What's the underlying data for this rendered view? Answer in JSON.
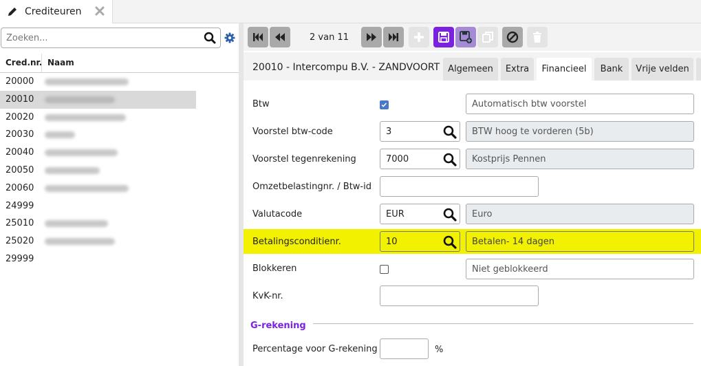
{
  "window": {
    "tab_title": "Crediteuren"
  },
  "list": {
    "search_placeholder": "Zoeken...",
    "columns": [
      "Cred.nr.",
      "Naam"
    ],
    "rows": [
      {
        "nr": "20000",
        "selected": false
      },
      {
        "nr": "20010",
        "selected": true
      },
      {
        "nr": "20020",
        "selected": false
      },
      {
        "nr": "20030",
        "selected": false
      },
      {
        "nr": "20040",
        "selected": false
      },
      {
        "nr": "20050",
        "selected": false
      },
      {
        "nr": "20060",
        "selected": false
      },
      {
        "nr": "24999",
        "selected": false
      },
      {
        "nr": "25010",
        "selected": false
      },
      {
        "nr": "25020",
        "selected": false
      },
      {
        "nr": "29999",
        "selected": false
      }
    ]
  },
  "toolbar": {
    "pager": "2 van 11"
  },
  "record": {
    "title": "20010 - Intercompu B.V. - ZANDVOORT",
    "tabs": [
      "Algemeen",
      "Extra",
      "Financieel",
      "Bank",
      "Vrije velden"
    ],
    "active_tab": "Financieel"
  },
  "form": {
    "btw": {
      "label": "Btw",
      "checked": true,
      "desc": "Automatisch btw voorstel"
    },
    "voorstel_btw": {
      "label": "Voorstel btw-code",
      "value": "3",
      "desc": "BTW hoog te vorderen (5b)"
    },
    "voorstel_tegen": {
      "label": "Voorstel tegenrekening",
      "value": "7000",
      "desc": "Kostprijs Pennen"
    },
    "omzetbelasting": {
      "label": "Omzetbelastingnr. / Btw-id",
      "value": ""
    },
    "valuta": {
      "label": "Valutacode",
      "value": "EUR",
      "desc": "Euro"
    },
    "betaling": {
      "label": "Betalingsconditienr.",
      "value": "10",
      "desc": "Betalen- 14 dagen"
    },
    "blokkeren": {
      "label": "Blokkeren",
      "checked": false,
      "desc": "Niet geblokkeerd"
    },
    "kvk": {
      "label": "KvK-nr.",
      "value": ""
    },
    "g_section": "G-rekening",
    "percentage": {
      "label": "Percentage voor G-rekening",
      "value": "",
      "unit": "%"
    }
  },
  "colors": {
    "accent": "#7a22e0",
    "highlight": "#f2f200",
    "checkbox": "#4a78c8"
  }
}
